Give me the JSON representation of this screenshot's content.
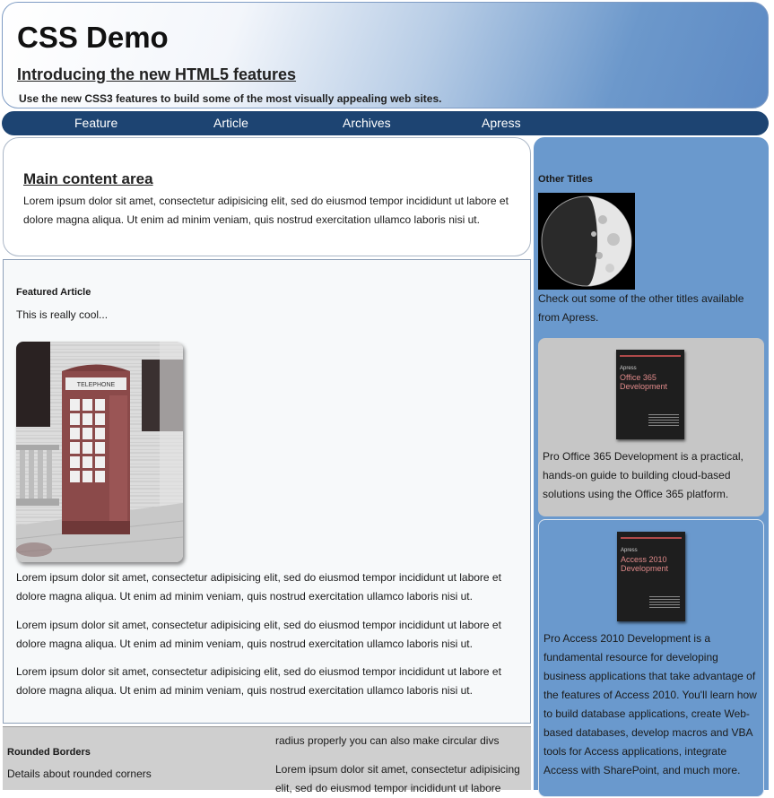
{
  "header": {
    "title": "CSS Demo",
    "tagline": "Introducing the new HTML5 features",
    "subtagline": "Use the new CSS3 features to build some of the most visually appealing web sites."
  },
  "nav": {
    "items": [
      "Feature",
      "Article",
      "Archives",
      "Apress"
    ]
  },
  "main": {
    "title": "Main content area",
    "text": "Lorem ipsum dolor sit amet, consectetur adipisicing elit, sed do eiusmod tempor incididunt ut labore et dolore magna aliqua. Ut enim ad minim veniam, quis nostrud exercitation ullamco laboris nisi ut."
  },
  "featured": {
    "heading": "Featured Article",
    "subtitle": "This is really cool...",
    "image_sign": "TELEPHONE",
    "paragraphs": [
      "Lorem ipsum dolor sit amet, consectetur adipisicing elit, sed do eiusmod tempor incididunt ut labore et dolore magna aliqua. Ut enim ad minim veniam, quis nostrud exercitation ullamco laboris nisi ut.",
      "Lorem ipsum dolor sit amet, consectetur adipisicing elit, sed do eiusmod tempor incididunt ut labore et dolore magna aliqua. Ut enim ad minim veniam, quis nostrud exercitation ullamco laboris nisi ut.",
      "Lorem ipsum dolor sit amet, consectetur adipisicing elit, sed do eiusmod tempor incididunt ut labore et dolore magna aliqua. Ut enim ad minim veniam, quis nostrud exercitation ullamco laboris nisi ut."
    ]
  },
  "rounded": {
    "heading": "Rounded Borders",
    "subtitle": "Details about rounded corners",
    "col_line": "radius properly you can also make circular divs",
    "col_para": "Lorem ipsum dolor sit amet, consectetur adipisicing elit, sed do eiusmod tempor incididunt ut labore"
  },
  "sidebar": {
    "title": "Other Titles",
    "intro": "Check out some of the other titles available from Apress.",
    "books": [
      {
        "cover_publisher": "Apress",
        "cover_title": "Office 365 Development",
        "description": "Pro Office 365 Development is a practical, hands-on guide to building cloud-based solutions using the Office 365 platform."
      },
      {
        "cover_publisher": "Apress",
        "cover_title": "Access 2010 Development",
        "description": "Pro Access 2010 Development is a fundamental resource for developing business applications that take advantage of the features of Access 2010. You'll learn how to build database applications, create Web-based databases, develop macros and VBA tools for Access applications, integrate Access with SharePoint, and much more."
      }
    ]
  }
}
